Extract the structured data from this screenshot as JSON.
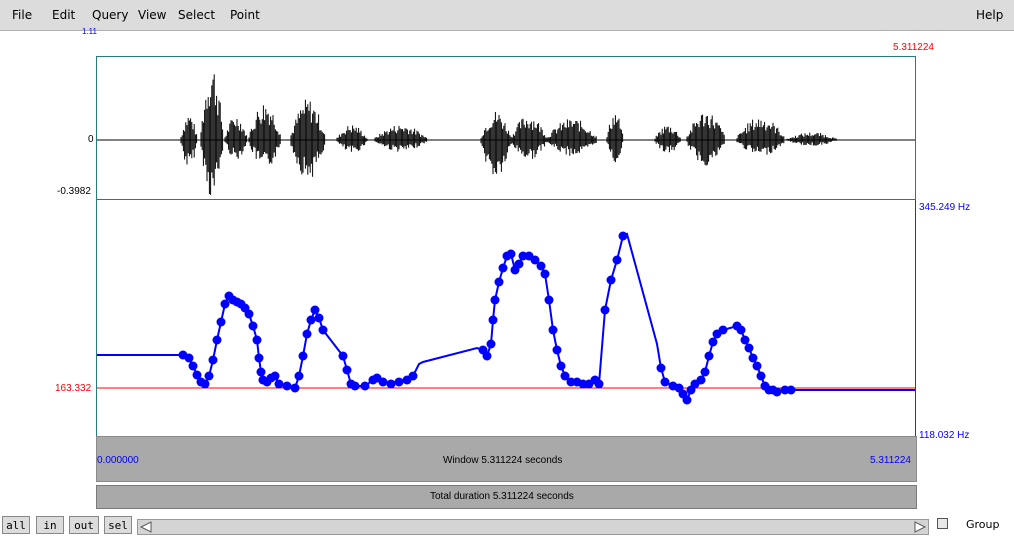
{
  "menu": {
    "file": "File",
    "edit": "Edit",
    "query": "Query",
    "view": "View",
    "select": "Select",
    "point": "Point",
    "help": "Help"
  },
  "waveform": {
    "top_left_label": "1.11",
    "end_time_label": "5.311224",
    "zero_label": "0",
    "min_label": "-0.3982"
  },
  "pitch": {
    "max_label": "345.249 Hz",
    "min_label": "118.032 Hz",
    "cursor_label": "163.332",
    "colors": {
      "pitch": "#0000ff",
      "cursor": "#ff0000"
    }
  },
  "window_bar": {
    "start": "0.000000",
    "text": "Window 5.311224 seconds",
    "end": "5.311224"
  },
  "total_bar": {
    "text": "Total duration 5.311224 seconds"
  },
  "buttons": {
    "all": "all",
    "in": "in",
    "out": "out",
    "sel": "sel"
  },
  "group_label": "Group"
}
